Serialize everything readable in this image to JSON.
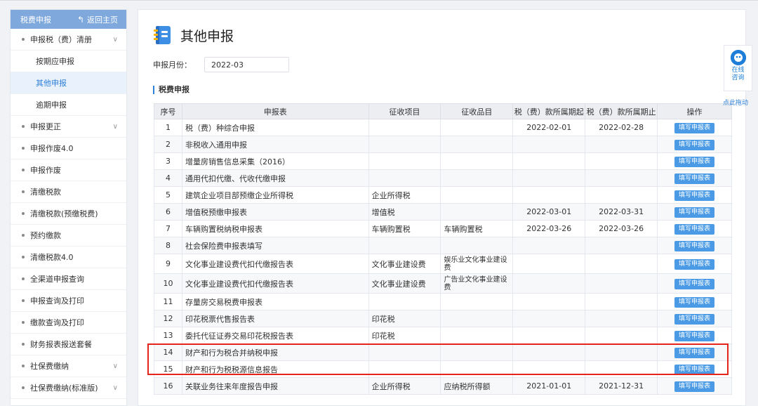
{
  "sidebar": {
    "header_title": "税费申报",
    "home_label": "返回主页",
    "groups": [
      {
        "label": "申报税（费）清册",
        "expandable": true,
        "children": [
          "按期应申报",
          "其他申报",
          "逾期申报"
        ],
        "active_child": 1
      },
      {
        "label": "申报更正",
        "expandable": true
      },
      {
        "label": "申报作废4.0",
        "expandable": false
      },
      {
        "label": "申报作废",
        "expandable": false
      },
      {
        "label": "清缴税款",
        "expandable": false
      },
      {
        "label": "清缴税款(预缴税费)",
        "expandable": false
      },
      {
        "label": "预约缴款",
        "expandable": false
      },
      {
        "label": "清缴税款4.0",
        "expandable": false
      },
      {
        "label": "全渠道申报查询",
        "expandable": false
      },
      {
        "label": "申报查询及打印",
        "expandable": false
      },
      {
        "label": "缴款查询及打印",
        "expandable": false
      },
      {
        "label": "财务报表报送套餐",
        "expandable": false
      },
      {
        "label": "社保费缴纳",
        "expandable": true
      },
      {
        "label": "社保费缴纳(标准版)",
        "expandable": true
      }
    ]
  },
  "main": {
    "title": "其他申报",
    "month_label": "申报月份：",
    "month_value": "2022-03",
    "section_title": "税费申报",
    "columns": [
      "序号",
      "申报表",
      "征收项目",
      "征收品目",
      "税（费）款所属期起",
      "税（费）款所属期止",
      "操作"
    ],
    "button_label": "填写申报表",
    "rows": [
      {
        "no": "1",
        "form": "税（费）种综合申报",
        "item": "",
        "sub": "",
        "start": "2022-02-01",
        "end": "2022-02-28"
      },
      {
        "no": "2",
        "form": "非税收入通用申报",
        "item": "",
        "sub": "",
        "start": "",
        "end": ""
      },
      {
        "no": "3",
        "form": "增量房销售信息采集（2016）",
        "item": "",
        "sub": "",
        "start": "",
        "end": ""
      },
      {
        "no": "4",
        "form": "通用代扣代缴、代收代缴申报",
        "item": "",
        "sub": "",
        "start": "",
        "end": ""
      },
      {
        "no": "5",
        "form": "建筑企业项目部预缴企业所得税",
        "item": "企业所得税",
        "sub": "",
        "start": "",
        "end": ""
      },
      {
        "no": "6",
        "form": "增值税预缴申报表",
        "item": "增值税",
        "sub": "",
        "start": "2022-03-01",
        "end": "2022-03-31"
      },
      {
        "no": "7",
        "form": "车辆购置税纳税申报表",
        "item": "车辆购置税",
        "sub": "车辆购置税",
        "start": "2022-03-26",
        "end": "2022-03-26"
      },
      {
        "no": "8",
        "form": "社会保险费申报表填写",
        "item": "",
        "sub": "",
        "start": "",
        "end": ""
      },
      {
        "no": "9",
        "form": "文化事业建设费代扣代缴报告表",
        "item": "文化事业建设费",
        "sub": "娱乐业文化事业建设费",
        "start": "",
        "end": ""
      },
      {
        "no": "10",
        "form": "文化事业建设费代扣代缴报告表",
        "item": "文化事业建设费",
        "sub": "广告业文化事业建设费",
        "start": "",
        "end": ""
      },
      {
        "no": "11",
        "form": "存量房交易税费申报表",
        "item": "",
        "sub": "",
        "start": "",
        "end": ""
      },
      {
        "no": "12",
        "form": "印花税票代售报告表",
        "item": "印花税",
        "sub": "",
        "start": "",
        "end": ""
      },
      {
        "no": "13",
        "form": "委托代征证券交易印花税报告表",
        "item": "印花税",
        "sub": "",
        "start": "",
        "end": ""
      },
      {
        "no": "14",
        "form": "财产和行为税合并纳税申报",
        "item": "",
        "sub": "",
        "start": "",
        "end": ""
      },
      {
        "no": "15",
        "form": "财产和行为税税源信息报告",
        "item": "",
        "sub": "",
        "start": "",
        "end": ""
      },
      {
        "no": "16",
        "form": "关联业务往来年度报告申报",
        "item": "企业所得税",
        "sub": "应纳税所得额",
        "start": "2021-01-01",
        "end": "2021-12-31"
      }
    ]
  },
  "consult": {
    "label_line1": "在线",
    "label_line2": "咨询",
    "drag_hint": "点此拖动"
  },
  "colors": {
    "accent": "#2d7fd8",
    "header_blue": "#7fa8dc",
    "button_blue": "#4a9ae6",
    "highlight_red": "#e5251c"
  }
}
